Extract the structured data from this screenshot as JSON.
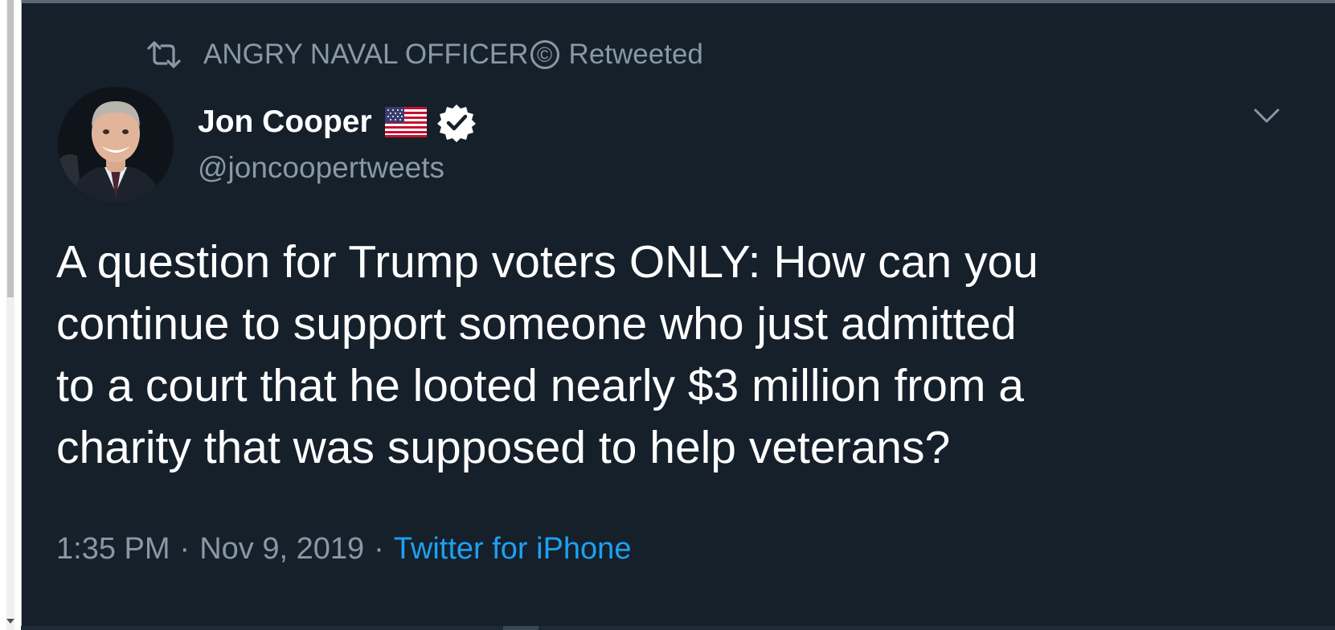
{
  "retweet": {
    "icon": "retweet-icon",
    "retweeter_name": "ANGRY NAVAL OFFICER",
    "retweeter_badge": "©",
    "label": "Retweeted"
  },
  "author": {
    "display_name": "Jon Cooper",
    "handle": "@joncoopertweets",
    "flag_icon": "us-flag-icon",
    "verified_icon": "verified-badge-icon"
  },
  "tweet": {
    "text": "A question for Trump voters ONLY: How can you\ncontinue to support someone who just admitted\nto a court that he looted nearly $3 million from a\ncharity that was supposed to help veterans?",
    "time": "1:35 PM",
    "separator": "·",
    "date": "Nov 9, 2019",
    "source": "Twitter for iPhone"
  },
  "menu": {
    "icon": "chevron-down-icon"
  },
  "colors": {
    "background": "#15202b",
    "text_primary": "#ffffff",
    "text_secondary": "#8899a6",
    "link": "#1da1f2"
  }
}
